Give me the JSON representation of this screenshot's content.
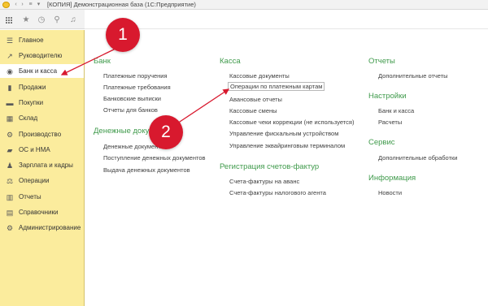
{
  "window": {
    "title": "[КОПИЯ] Демонстрационная база  (1С:Предприятие)"
  },
  "sidebar": {
    "items": [
      {
        "label": "Главное",
        "icon": "menu-icon"
      },
      {
        "label": "Руководителю",
        "icon": "trend-icon"
      },
      {
        "label": "Банк и касса",
        "icon": "coin-icon"
      },
      {
        "label": "Продажи",
        "icon": "sales-icon"
      },
      {
        "label": "Покупки",
        "icon": "cart-icon"
      },
      {
        "label": "Склад",
        "icon": "warehouse-icon"
      },
      {
        "label": "Производство",
        "icon": "factory-icon"
      },
      {
        "label": "ОС и НМА",
        "icon": "truck-icon"
      },
      {
        "label": "Зарплата и кадры",
        "icon": "person-icon"
      },
      {
        "label": "Операции",
        "icon": "scale-icon"
      },
      {
        "label": "Отчеты",
        "icon": "bar-chart-icon"
      },
      {
        "label": "Справочники",
        "icon": "book-icon"
      },
      {
        "label": "Администрирование",
        "icon": "gear-icon"
      }
    ]
  },
  "sections": {
    "bank": {
      "title": "Банк",
      "links": [
        "Платежные поручения",
        "Платежные требования",
        "Банковские выписки",
        "Отчеты для банков"
      ]
    },
    "money_docs": {
      "title": "Денежные документ",
      "links": [
        "Денежные документ",
        "Поступление денежных документов",
        "Выдача денежных документов"
      ]
    },
    "cash": {
      "title": "Касса",
      "links": [
        "Кассовые документы",
        "Операции по платежным картам",
        "Авансовые отчеты",
        "Кассовые смены",
        "Кассовые чеки коррекции (не используется)",
        "Управление фискальным устройством",
        "Управление эквайринговым терминалом"
      ]
    },
    "invoices": {
      "title": "Регистрация счетов-фактур",
      "links": [
        "Счета-фактуры на аванс",
        "Счета-фактуры налогового агента"
      ]
    },
    "reports": {
      "title": "Отчеты",
      "links": [
        "Дополнительные отчеты"
      ]
    },
    "settings": {
      "title": "Настройки",
      "links": [
        "Банк и касса",
        "Расчеты"
      ]
    },
    "service": {
      "title": "Сервис",
      "links": [
        "Дополнительные обработки"
      ]
    },
    "info": {
      "title": "Информация",
      "links": [
        "Новости"
      ]
    }
  },
  "annotations": {
    "badge1": "1",
    "badge2": "2",
    "color": "#d8192e"
  },
  "colors": {
    "sidebar": "#fbec9d",
    "section_heading": "#3f9a4b"
  }
}
